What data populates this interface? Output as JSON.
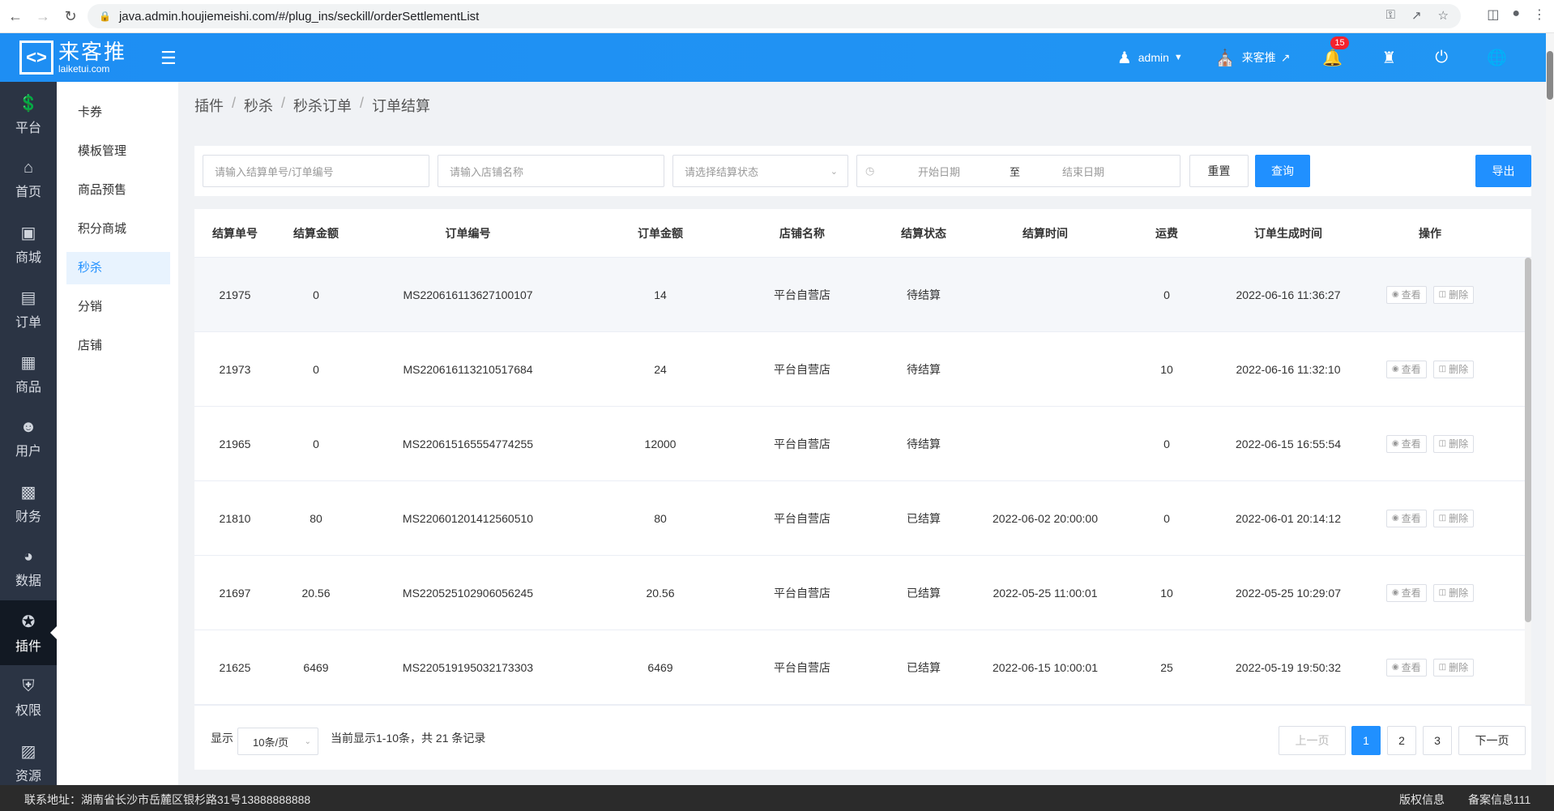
{
  "browser": {
    "url": "java.admin.houjiemeishi.com/#/plug_ins/seckill/orderSettlementList"
  },
  "header": {
    "logo_name": "来客推",
    "logo_domain": "laiketui.com",
    "user": "admin",
    "store": "来客推",
    "notifications": "15"
  },
  "sidebar": [
    {
      "label": "平台",
      "icon": "dollar-icon"
    },
    {
      "label": "首页",
      "icon": "home-icon"
    },
    {
      "label": "商城",
      "icon": "store-icon"
    },
    {
      "label": "订单",
      "icon": "clipboard-icon"
    },
    {
      "label": "商品",
      "icon": "box-icon"
    },
    {
      "label": "用户",
      "icon": "user-icon"
    },
    {
      "label": "财务",
      "icon": "wallet-icon"
    },
    {
      "label": "数据",
      "icon": "pie-chart-icon"
    },
    {
      "label": "插件",
      "icon": "puzzle-icon"
    },
    {
      "label": "权限",
      "icon": "shield-icon"
    },
    {
      "label": "资源",
      "icon": "image-icon"
    }
  ],
  "subnav": [
    "卡券",
    "模板管理",
    "商品预售",
    "积分商城",
    "秒杀",
    "分销",
    "店铺"
  ],
  "breadcrumb": [
    "插件",
    "秒杀",
    "秒杀订单",
    "订单结算"
  ],
  "filters": {
    "order_placeholder": "请输入结算单号/订单编号",
    "store_placeholder": "请输入店铺名称",
    "status_placeholder": "请选择结算状态",
    "start_placeholder": "开始日期",
    "range_sep": "至",
    "end_placeholder": "结束日期",
    "reset": "重置",
    "query": "查询",
    "export": "导出"
  },
  "table": {
    "columns": [
      "结算单号",
      "结算金额",
      "订单编号",
      "订单金额",
      "店铺名称",
      "结算状态",
      "结算时间",
      "运费",
      "订单生成时间",
      "操作"
    ],
    "view_label": "查看",
    "delete_label": "删除",
    "rows": [
      [
        "21975",
        "0",
        "MS220616113627100107",
        "14",
        "平台自营店",
        "待结算",
        "",
        "0",
        "2022-06-16 11:36:27"
      ],
      [
        "21973",
        "0",
        "MS220616113210517684",
        "24",
        "平台自营店",
        "待结算",
        "",
        "10",
        "2022-06-16 11:32:10"
      ],
      [
        "21965",
        "0",
        "MS220615165554774255",
        "12000",
        "平台自营店",
        "待结算",
        "",
        "0",
        "2022-06-15 16:55:54"
      ],
      [
        "21810",
        "80",
        "MS220601201412560510",
        "80",
        "平台自营店",
        "已结算",
        "2022-06-02 20:00:00",
        "0",
        "2022-06-01 20:14:12"
      ],
      [
        "21697",
        "20.56",
        "MS220525102906056245",
        "20.56",
        "平台自营店",
        "已结算",
        "2022-05-25 11:00:01",
        "10",
        "2022-05-25 10:29:07"
      ],
      [
        "21625",
        "6469",
        "MS220519195032173303",
        "6469",
        "平台自营店",
        "已结算",
        "2022-06-15 10:00:01",
        "25",
        "2022-05-19 19:50:32"
      ]
    ]
  },
  "pager": {
    "show_label": "显示",
    "page_size": "10条/页",
    "summary": "当前显示1-10条，共 21 条记录",
    "prev": "上一页",
    "pages": [
      "1",
      "2",
      "3"
    ],
    "next": "下一页"
  },
  "footer": {
    "contact": "联系地址：湖南省长沙市岳麓区银杉路31号13888888888",
    "copyright": "版权信息",
    "record": "备案信息111"
  }
}
